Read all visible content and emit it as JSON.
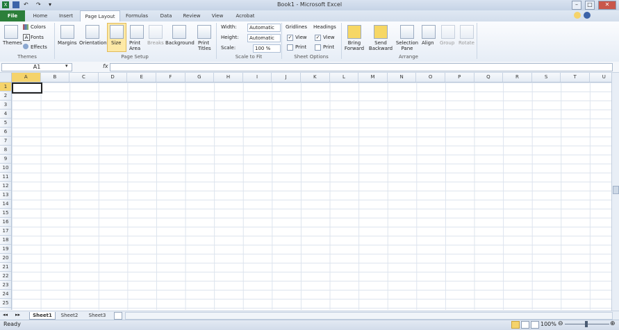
{
  "window": {
    "title": "Book1 - Microsoft Excel",
    "controls": {
      "minimize": "–",
      "maximize": "□",
      "close": "✕"
    }
  },
  "tabs": [
    "File",
    "Home",
    "Insert",
    "Page Layout",
    "Formulas",
    "Data",
    "Review",
    "View",
    "Acrobat"
  ],
  "ribbon": {
    "themes": {
      "themes_label": "Themes",
      "colors": "Colors",
      "fonts": "Fonts",
      "effects": "Effects",
      "group_label": "Themes"
    },
    "page_setup": {
      "margins": "Margins",
      "orientation": "Orientation",
      "size": "Size",
      "print_area": "Print Area",
      "breaks": "Breaks",
      "background": "Background",
      "print_titles": "Print Titles",
      "group_label": "Page Setup"
    },
    "scale_to_fit": {
      "width_label": "Width:",
      "width_value": "Automatic",
      "height_label": "Height:",
      "height_value": "Automatic",
      "scale_label": "Scale:",
      "scale_value": "100 %",
      "group_label": "Scale to Fit"
    },
    "sheet_options": {
      "gridlines": "Gridlines",
      "headings": "Headings",
      "view": "View",
      "print": "Print",
      "group_label": "Sheet Options"
    },
    "arrange": {
      "bring_forward": "Bring Forward",
      "send_backward": "Send Backward",
      "selection_pane": "Selection Pane",
      "align": "Align",
      "group": "Group",
      "rotate": "Rotate",
      "group_label": "Arrange"
    }
  },
  "formula_bar": {
    "name_box": "A1",
    "fx": "fx",
    "value": ""
  },
  "grid": {
    "columns": [
      "A",
      "B",
      "C",
      "D",
      "E",
      "F",
      "G",
      "H",
      "I",
      "J",
      "K",
      "L",
      "M",
      "N",
      "O",
      "P",
      "Q",
      "R",
      "S",
      "T",
      "U"
    ],
    "rows": [
      "1",
      "2",
      "3",
      "4",
      "5",
      "6",
      "7",
      "8",
      "9",
      "10",
      "11",
      "12",
      "13",
      "14",
      "15",
      "16",
      "17",
      "18",
      "19",
      "20",
      "21",
      "22",
      "23",
      "24",
      "25"
    ],
    "active_cell": "A1"
  },
  "sheets": [
    "Sheet1",
    "Sheet2",
    "Sheet3"
  ],
  "status": {
    "mode": "Ready",
    "zoom": "100%"
  },
  "colors": {
    "file_tab": "#2c7f3a",
    "active_header": "#f5d36b"
  }
}
